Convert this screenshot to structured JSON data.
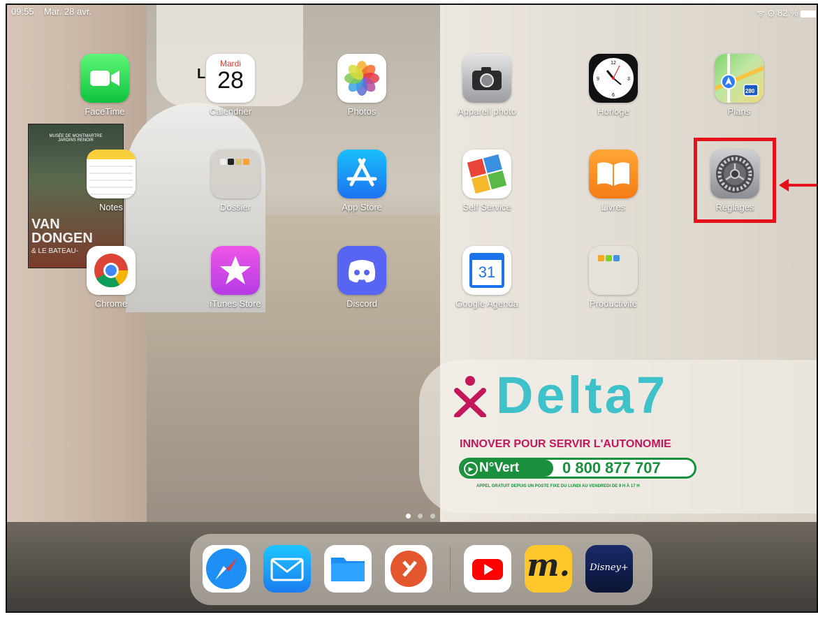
{
  "status_bar": {
    "time": "09:55",
    "date": "Mar. 28 avr.",
    "battery": "82 %"
  },
  "calendar_icon": {
    "weekday": "Mardi",
    "day": "28"
  },
  "google_calendar_day": "31",
  "widget_text": "L        ce",
  "apps": [
    {
      "label": "FaceTime"
    },
    {
      "label": "Calendrier"
    },
    {
      "label": "Photos"
    },
    {
      "label": "Appareil photo"
    },
    {
      "label": "Horloge"
    },
    {
      "label": "Plans"
    },
    {
      "label": "Notes"
    },
    {
      "label": "Dossier"
    },
    {
      "label": "App Store"
    },
    {
      "label": "Self Service"
    },
    {
      "label": "Livres"
    },
    {
      "label": "Réglages"
    },
    {
      "label": "Chrome"
    },
    {
      "label": "iTunes Store"
    },
    {
      "label": "Discord"
    },
    {
      "label": "Google Agenda"
    },
    {
      "label": "Productivité"
    }
  ],
  "maps_badge": "280",
  "dock": [
    "Safari",
    "Mail",
    "Fichiers",
    "Microsoft Remote Desktop",
    "YouTube",
    "McDonald's",
    "Disney+"
  ],
  "disney_text": "Disney+",
  "poster": {
    "line1": "MUSÉE DE MONTMARTRE",
    "line2": "JARDINS RENOIR",
    "line3": "VAN",
    "line4": "DONGEN",
    "line5": "& LE BATEAU-"
  },
  "banner": {
    "brand": "Delta7",
    "tagline": "INNOVER POUR SERVIR L'AUTONOMIE",
    "n_vert": "N°Vert",
    "phone": "0 800 877 707",
    "note": "APPEL GRATUIT DEPUIS UN POSTE FIXE DU LUNDI AU VENDREDI DE 9 H À 17 H"
  },
  "colors": {
    "highlight": "#e4111b",
    "delta_teal": "#3ec1c9",
    "delta_green": "#1a8f3c",
    "delta_red": "#c2185b"
  }
}
